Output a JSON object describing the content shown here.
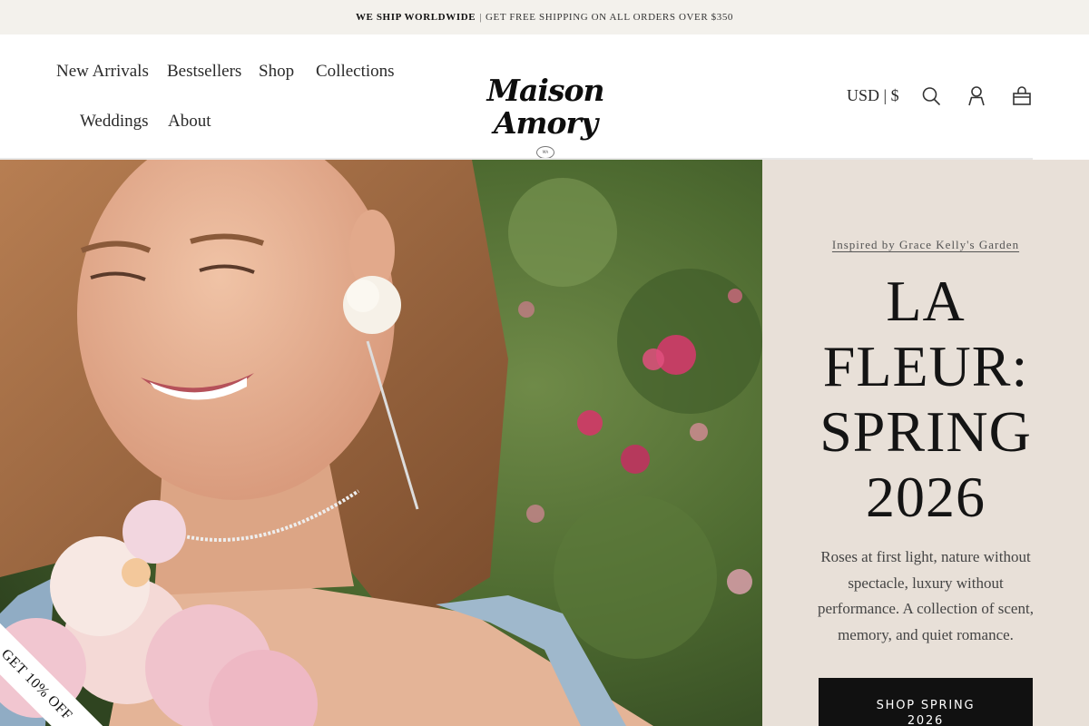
{
  "announcement": {
    "bold_text": "WE SHIP WORLDWIDE",
    "separator": "|",
    "text": "GET FREE SHIPPING ON ALL ORDERS OVER $350"
  },
  "nav": {
    "items": [
      "New Arrivals",
      "Bestsellers",
      "Shop",
      "Collections",
      "Weddings",
      "About"
    ]
  },
  "brand": {
    "name": "Maison Amory",
    "seal_text": "MA"
  },
  "header_actions": {
    "currency": "USD | $",
    "icons": [
      "search-icon",
      "account-icon",
      "cart-icon"
    ]
  },
  "hero": {
    "kicker": "Inspired by Grace Kelly's Garden",
    "headline_lines": [
      "LA",
      "FLEUR:",
      "SPRING",
      "2026"
    ],
    "blurb": "Roses at first light, nature without spectacle, luxury without performance. A collection of scent, memory, and quiet romance.",
    "cta_lines": [
      "SHOP SPRING",
      "2026"
    ]
  },
  "discount_tab": {
    "label": "GET 10% OFF"
  },
  "colors": {
    "announcement_bg": "#f3f1ec",
    "panel_bg": "#e8e0d8",
    "cta_bg": "#111111",
    "text": "#1a1a1a"
  }
}
